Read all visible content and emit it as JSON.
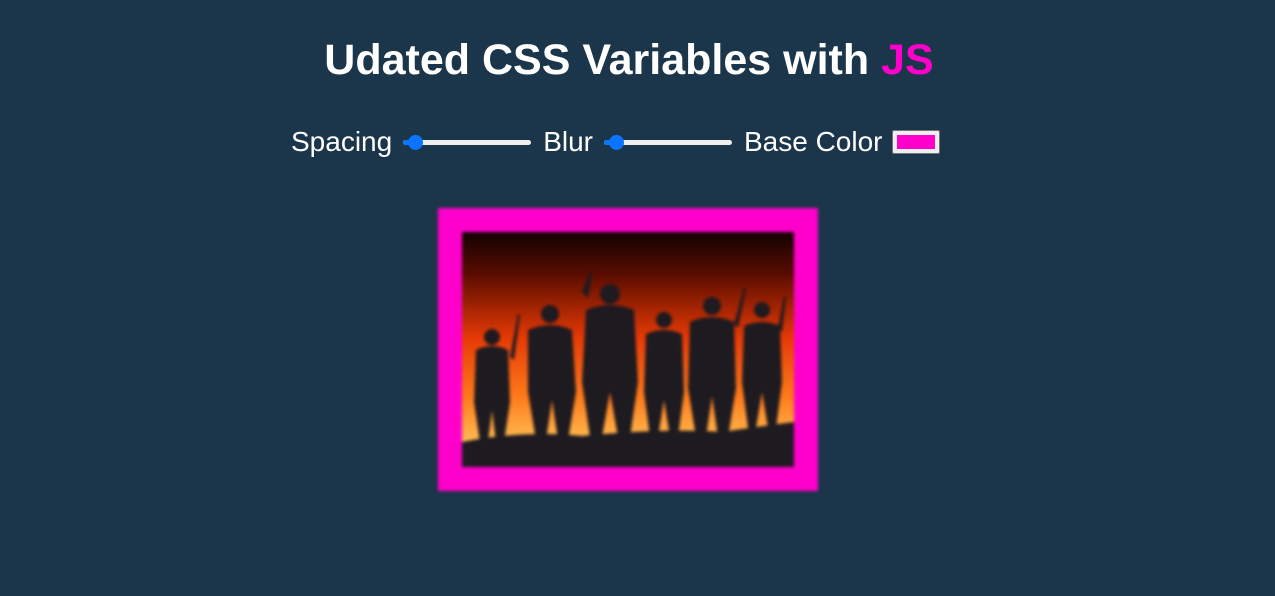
{
  "header": {
    "title_main": "Udated CSS Variables with ",
    "title_highlight": "JS"
  },
  "controls": {
    "spacing_label": "Spacing",
    "spacing_value": 0.1,
    "blur_label": "Blur",
    "blur_value": 0.1,
    "base_color_label": "Base Color",
    "base_color": "#ff00cc"
  },
  "colors": {
    "background": "#1b354a",
    "accent": "#ff00cc",
    "slider": "#0b75ff"
  }
}
